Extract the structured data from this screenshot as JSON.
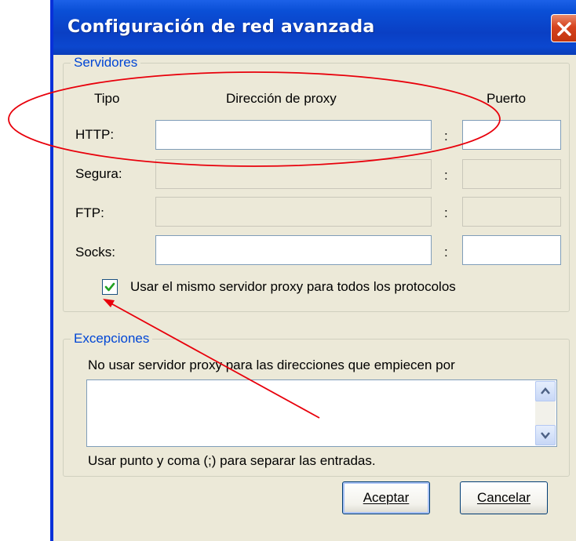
{
  "window": {
    "title": "Configuración de red avanzada",
    "close_icon": "close-icon"
  },
  "servers": {
    "legend": "Servidores",
    "header_type": "Tipo",
    "header_address": "Dirección de proxy",
    "header_port": "Puerto",
    "separator": ":",
    "rows": [
      {
        "label": "HTTP:",
        "address": "",
        "port": "",
        "enabled": true
      },
      {
        "label": "Segura:",
        "address": "",
        "port": "",
        "enabled": false
      },
      {
        "label": "FTP:",
        "address": "",
        "port": "",
        "enabled": false
      },
      {
        "label": "Socks:",
        "address": "",
        "port": "",
        "enabled": true
      }
    ],
    "same_proxy_label": "Usar el mismo servidor proxy para todos los protocolos",
    "same_proxy_checked": true
  },
  "exceptions": {
    "legend": "Excepciones",
    "description": "No usar servidor proxy para las direcciones que empiecen por",
    "value": "",
    "hint": "Usar punto y coma (;) para separar las entradas."
  },
  "buttons": {
    "accept": "Aceptar",
    "cancel": "Cancelar"
  },
  "annotation": {
    "color": "#e8000b"
  }
}
